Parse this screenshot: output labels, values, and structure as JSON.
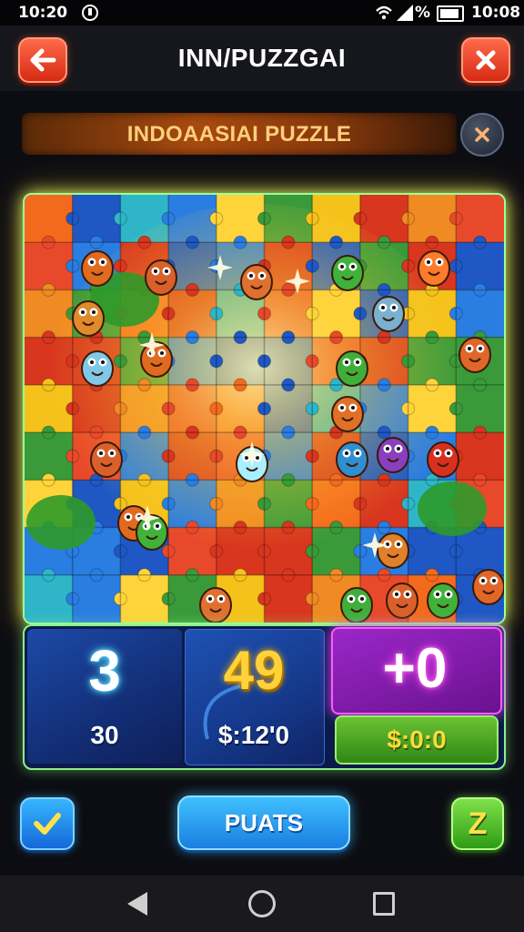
{
  "status_bar": {
    "time_left": "10:20",
    "battery_pct": "%",
    "time_right": "10:08"
  },
  "header": {
    "title": "INN/PUZZGAI",
    "back_icon": "back-arrow-icon",
    "close_icon": "close-x-icon"
  },
  "banner": {
    "title": "INDOAASIAI PUZZLE"
  },
  "scores": {
    "cell1": {
      "big": "3",
      "small": "30"
    },
    "cell2": {
      "big": "49",
      "small": "$:12'0"
    },
    "cell3": {
      "big": "+0",
      "button": "$:0:0"
    }
  },
  "actions": {
    "main_label": "PUATS",
    "right_label": "Z"
  },
  "colors": {
    "accent_blue": "#1a7ee0",
    "accent_green": "#2f9c16",
    "accent_red": "#d62a14",
    "accent_purple": "#9a27c8"
  }
}
